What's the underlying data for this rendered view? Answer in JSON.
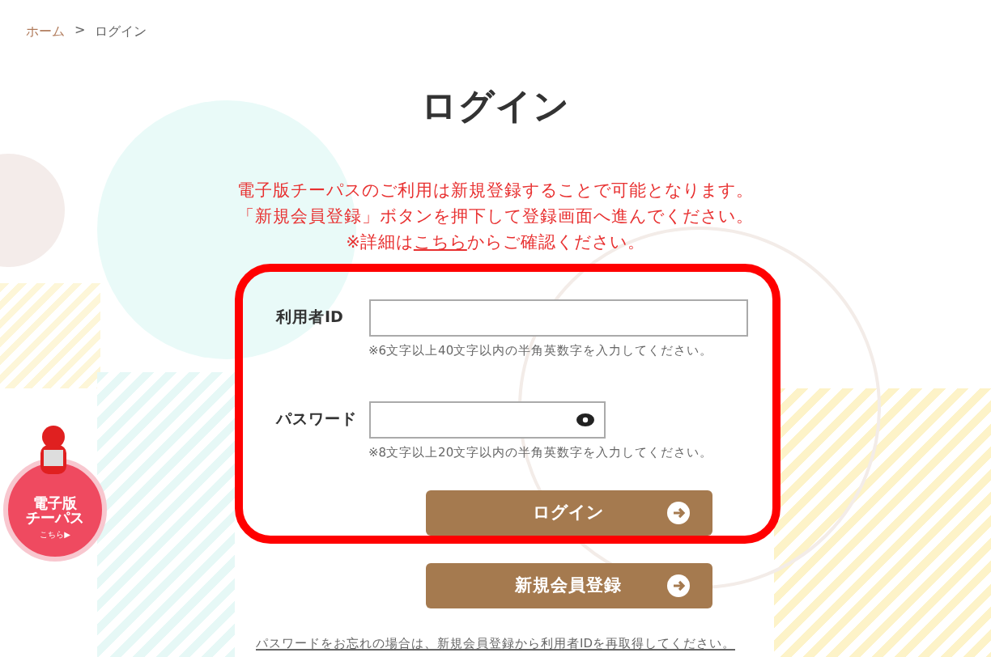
{
  "breadcrumb": [
    {
      "label": "ホーム",
      "link": true
    },
    {
      "label": "ログイン",
      "link": false
    }
  ],
  "breadcrumb_separator": ">",
  "title": "ログイン",
  "notice": [
    "電子版チーパスのご利用は新規登録することで可能となります。",
    "「新規会員登録」ボタンを押下して登録画面へ進んでください。",
    {
      "before": "※詳細は",
      "link": "こちら",
      "after": "からご確認ください。"
    }
  ],
  "fields": [
    {
      "label": "利用者ID",
      "kind": "text",
      "hint": "※6文字以上40文字以内の半角英数字を入力してください。"
    },
    {
      "label": "パスワード",
      "kind": "password",
      "hint": "※8文字以上20文字以内の半角英数字を入力してください。"
    }
  ],
  "buttons": [
    {
      "label": "ログイン"
    },
    {
      "label": "新規会員登録"
    }
  ],
  "forgot_link": "パスワードをお忘れの場合は、新規会員登録から利用者IDを再取得してください。",
  "badge": {
    "lines": [
      "電子版",
      "チーパス"
    ],
    "link": "こちら▶"
  },
  "highlight": {
    "shown": true,
    "color": "#ff0000"
  }
}
